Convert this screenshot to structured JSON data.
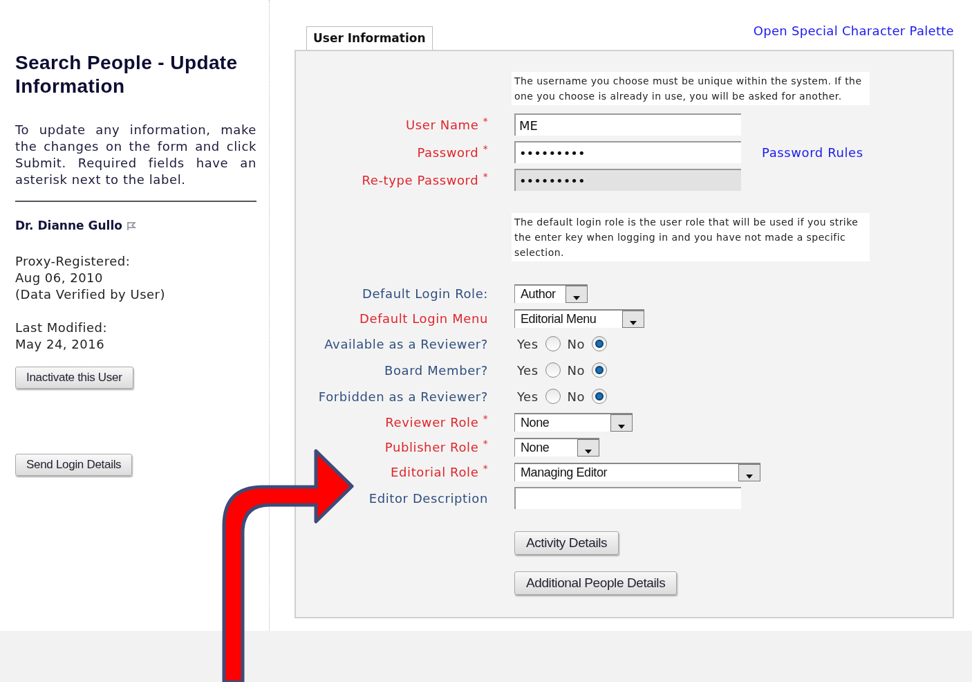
{
  "sidebar": {
    "title": "Search People - Update Information",
    "intro": "To update any information, make the changes on the form and click Submit. Required fields have an asterisk next to the label.",
    "person_name": "Dr. Dianne Gullo",
    "registered_label": "Proxy-Registered:",
    "registered_date": "Aug 06, 2010",
    "registered_note": "(Data Verified by User)",
    "modified_label": "Last Modified:",
    "modified_date": "May 24, 2016",
    "buttons": [
      "Inactivate this User",
      "Send Login Details"
    ]
  },
  "palette_link": "Open Special Character Palette",
  "tab": {
    "label": "User Information",
    "selected": true
  },
  "rows": [
    {
      "kind": "note",
      "text": "The username you choose must be unique within the system. If the one you choose is already in use, you will be asked for another."
    },
    {
      "kind": "text",
      "label": "User Name $^{*}$",
      "required": true,
      "value": "ME",
      "disabled": false
    },
    {
      "kind": "text",
      "label": "Password $^{*}$",
      "required": true,
      "value": "•••••••••",
      "disabled": false,
      "link": "Password Rules"
    },
    {
      "kind": "text",
      "label": "Re-type Password $^{*}$",
      "required": true,
      "value": "•••••••••",
      "disabled": true
    },
    {
      "kind": "note",
      "text": "The default login role is the user role that will be used if you strike the enter key when logging in and you have not made a specific selection."
    },
    {
      "kind": "select",
      "label": "Default Login Role:",
      "required": false,
      "value": "Author"
    },
    {
      "kind": "select",
      "label": "Default Login Menu",
      "required": true,
      "value": "Editorial Menu"
    },
    {
      "kind": "radio",
      "label": "Available as a Reviewer?",
      "required": false,
      "options": [
        {
          "label": "Yes",
          "selected": false
        },
        {
          "label": "No",
          "selected": true
        }
      ]
    },
    {
      "kind": "radio",
      "label": "Board Member?",
      "required": false,
      "options": [
        {
          "label": "Yes",
          "selected": false
        },
        {
          "label": "No",
          "selected": true
        }
      ]
    },
    {
      "kind": "radio",
      "label": "Forbidden as a Reviewer?",
      "required": false,
      "options": [
        {
          "label": "Yes",
          "selected": false
        },
        {
          "label": "No",
          "selected": true
        }
      ]
    },
    {
      "kind": "select",
      "label": "Reviewer Role $^{*}$",
      "required": true,
      "value": "None"
    },
    {
      "kind": "select",
      "label": "Publisher Role $^{*}$",
      "required": true,
      "value": "None"
    },
    {
      "kind": "select",
      "label": "Editorial Role $^{*}$",
      "required": true,
      "value": "Managing Editor"
    },
    {
      "kind": "text",
      "label": "Editor Description",
      "required": false,
      "value": "",
      "disabled": false
    },
    {
      "kind": "button",
      "text": "Activity Details"
    },
    {
      "kind": "button",
      "text": "Additional People Details"
    }
  ]
}
